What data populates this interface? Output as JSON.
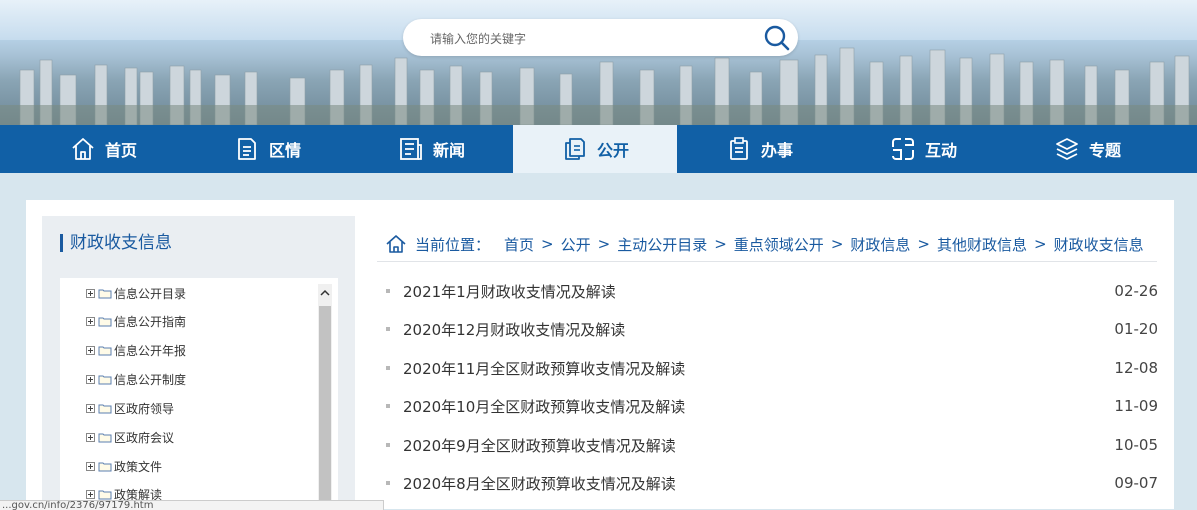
{
  "search": {
    "placeholder": "请输入您的关键字"
  },
  "nav": [
    {
      "label": "首页",
      "icon": "home-icon",
      "active": false
    },
    {
      "label": "区情",
      "icon": "document-icon",
      "active": false
    },
    {
      "label": "新闻",
      "icon": "news-icon",
      "active": false
    },
    {
      "label": "公开",
      "icon": "files-icon",
      "active": true
    },
    {
      "label": "办事",
      "icon": "clipboard-icon",
      "active": false
    },
    {
      "label": "互动",
      "icon": "interaction-icon",
      "active": false
    },
    {
      "label": "专题",
      "icon": "layers-icon",
      "active": false
    }
  ],
  "sidebar": {
    "title": "财政收支信息",
    "items": [
      "信息公开目录",
      "信息公开指南",
      "信息公开年报",
      "信息公开制度",
      "区政府领导",
      "区政府会议",
      "政策文件",
      "政策解读"
    ]
  },
  "breadcrumb": {
    "label": "当前位置：",
    "items": [
      "首页",
      "公开",
      "主动公开目录",
      "重点领域公开",
      "财政信息",
      "其他财政信息",
      "财政收支信息"
    ],
    "separator": ">"
  },
  "news": [
    {
      "title": "2021年1月财政收支情况及解读",
      "date": "02-26"
    },
    {
      "title": "2020年12月财政收支情况及解读",
      "date": "01-20"
    },
    {
      "title": "2020年11月全区财政预算收支情况及解读",
      "date": "12-08"
    },
    {
      "title": "2020年10月全区财政预算收支情况及解读",
      "date": "11-09"
    },
    {
      "title": "2020年9月全区财政预算收支情况及解读",
      "date": "10-05"
    },
    {
      "title": "2020年8月全区财政预算收支情况及解读",
      "date": "09-07"
    }
  ],
  "status_url": "...gov.cn/info/2376/97179.htm",
  "colors": {
    "nav_bg": "#1160a6",
    "accent": "#1a5aa0",
    "active_bg": "#e9f2f8"
  }
}
